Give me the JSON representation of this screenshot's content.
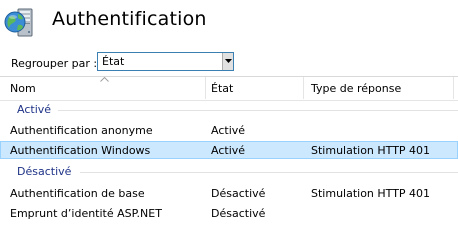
{
  "header": {
    "title": "Authentification",
    "icon": "iis-server-globe-icon"
  },
  "group_by": {
    "label": "Regrouper par :",
    "selected": "État"
  },
  "columns": {
    "name": "Nom",
    "state": "État",
    "response_type": "Type de réponse"
  },
  "groups": [
    {
      "label": "Activé",
      "rows": [
        {
          "name": "Authentification anonyme",
          "state": "Activé",
          "response_type": "",
          "selected": false
        },
        {
          "name": "Authentification Windows",
          "state": "Activé",
          "response_type": "Stimulation HTTP 401",
          "selected": true
        }
      ]
    },
    {
      "label": "Désactivé",
      "rows": [
        {
          "name": "Authentification de base",
          "state": "Désactivé",
          "response_type": "Stimulation HTTP 401",
          "selected": false
        },
        {
          "name": "Emprunt d’identité ASP.NET",
          "state": "Désactivé",
          "response_type": "",
          "selected": false
        }
      ]
    }
  ],
  "colors": {
    "selection_bg": "#cce8ff",
    "selection_border": "#99d1ff",
    "group_header_text": "#1e3287",
    "dropdown_border": "#3c7fb1"
  }
}
